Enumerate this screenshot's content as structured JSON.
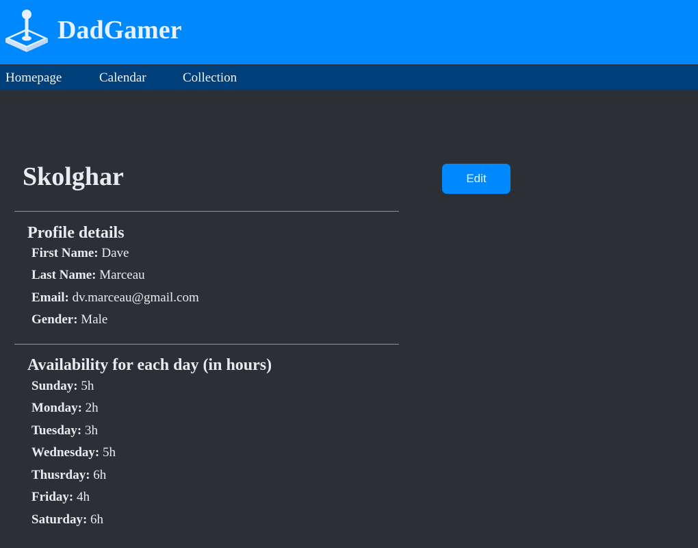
{
  "header": {
    "logo_icon": "joystick-icon",
    "brand": "DadGamer",
    "color": "#0088ff"
  },
  "nav": {
    "items": [
      "Homepage",
      "Calendar",
      "Collection"
    ],
    "color": "#003f7a"
  },
  "profile": {
    "username": "Skolghar",
    "edit_label": "Edit",
    "details_title": "Profile details",
    "details": [
      {
        "label": "First Name:",
        "value": "Dave"
      },
      {
        "label": "Last Name:",
        "value": "Marceau"
      },
      {
        "label": "Email:",
        "value": "dv.marceau@gmail.com"
      },
      {
        "label": "Gender:",
        "value": "Male"
      }
    ],
    "availability_title": "Availability for each day (in hours)",
    "availability": [
      {
        "label": "Sunday:",
        "value": "5h"
      },
      {
        "label": "Monday:",
        "value": "2h"
      },
      {
        "label": "Tuesday:",
        "value": "3h"
      },
      {
        "label": "Wednesday:",
        "value": "5h"
      },
      {
        "label": "Thusrday:",
        "value": "6h"
      },
      {
        "label": "Friday:",
        "value": "4h"
      },
      {
        "label": "Saturday:",
        "value": "6h"
      }
    ]
  }
}
